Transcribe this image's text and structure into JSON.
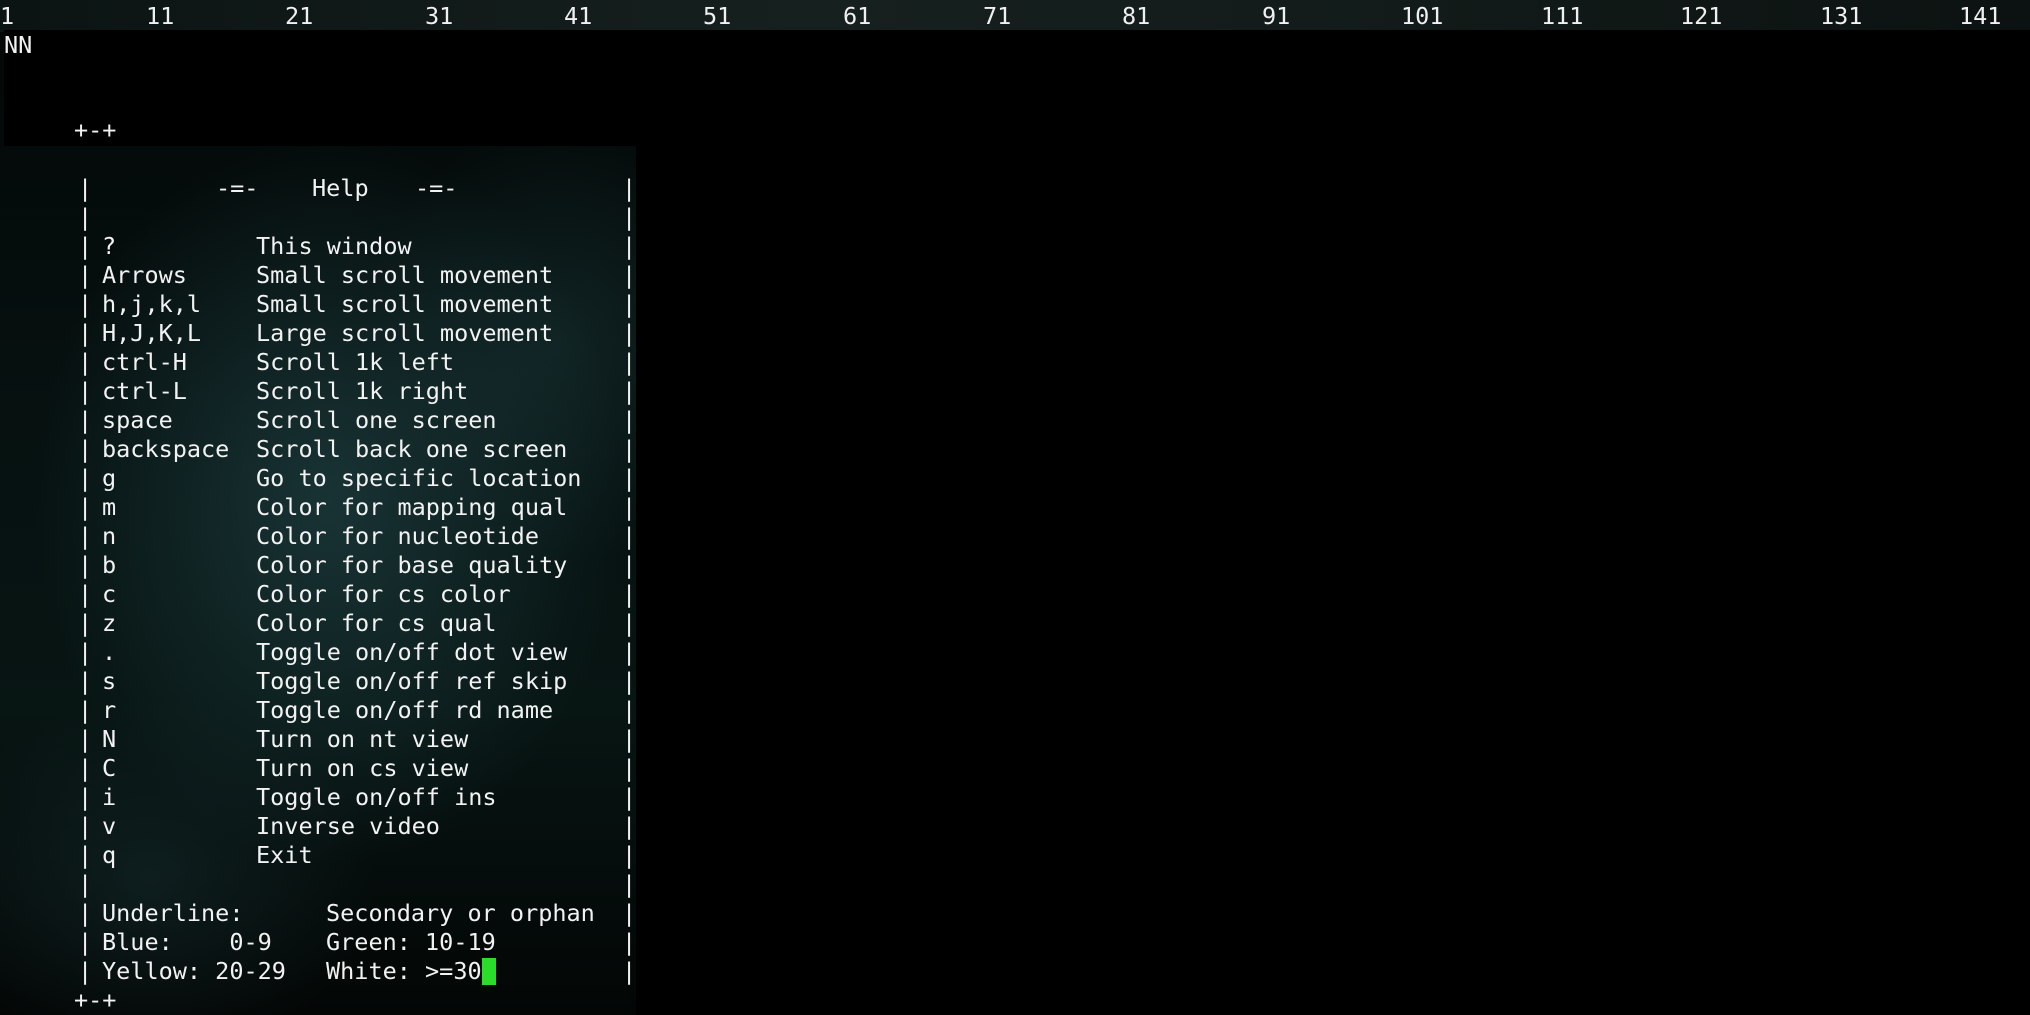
{
  "ruler": [
    "1",
    "11",
    "21",
    "31",
    "41",
    "51",
    "61",
    "71",
    "81",
    "91",
    "101",
    "111",
    "121",
    "131",
    "141"
  ],
  "reference": "NN",
  "help": {
    "corner_top": "+-+",
    "corner_bottom": "+-+",
    "border_char": "|",
    "title_deco": "-=-",
    "title": "Help",
    "shortcuts": [
      {
        "key": "?",
        "desc": "This window"
      },
      {
        "key": "Arrows",
        "desc": "Small scroll movement"
      },
      {
        "key": "h,j,k,l",
        "desc": "Small scroll movement"
      },
      {
        "key": "H,J,K,L",
        "desc": "Large scroll movement"
      },
      {
        "key": "ctrl-H",
        "desc": "Scroll 1k left"
      },
      {
        "key": "ctrl-L",
        "desc": "Scroll 1k right"
      },
      {
        "key": "space",
        "desc": "Scroll one screen"
      },
      {
        "key": "backspace",
        "desc": "Scroll back one screen"
      },
      {
        "key": "g",
        "desc": "Go to specific location"
      },
      {
        "key": "m",
        "desc": "Color for mapping qual"
      },
      {
        "key": "n",
        "desc": "Color for nucleotide"
      },
      {
        "key": "b",
        "desc": "Color for base quality"
      },
      {
        "key": "c",
        "desc": "Color for cs color"
      },
      {
        "key": "z",
        "desc": "Color for cs qual"
      },
      {
        "key": ".",
        "desc": "Toggle on/off dot view"
      },
      {
        "key": "s",
        "desc": "Toggle on/off ref skip"
      },
      {
        "key": "r",
        "desc": "Toggle on/off rd name"
      },
      {
        "key": "N",
        "desc": "Turn on nt view"
      },
      {
        "key": "C",
        "desc": "Turn on cs view"
      },
      {
        "key": "i",
        "desc": "Toggle on/off ins"
      },
      {
        "key": "v",
        "desc": "Inverse video"
      },
      {
        "key": "q",
        "desc": "Exit"
      }
    ],
    "legend": [
      {
        "left": "Underline:",
        "right": "Secondary or orphan"
      },
      {
        "left": "Blue:    0-9",
        "right": "Green: 10-19"
      },
      {
        "left": "Yellow: 20-29",
        "right": "White: >=30"
      }
    ]
  },
  "colors": {
    "cursor": "#2bdc2b",
    "text": "#f2f2f2",
    "background": "#000000"
  }
}
